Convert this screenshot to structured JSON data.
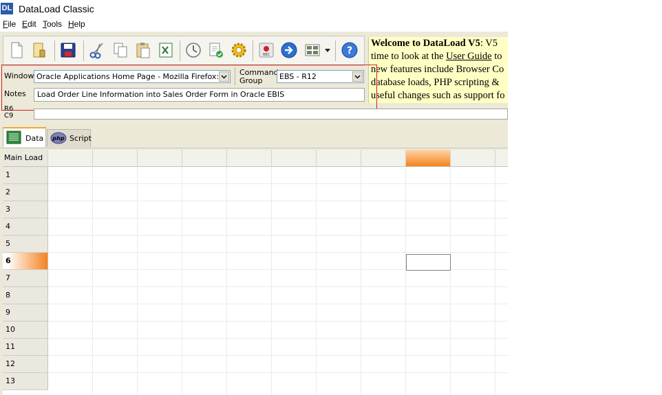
{
  "window": {
    "title": "DataLoad Classic",
    "logo_text": "DL"
  },
  "menu": [
    {
      "label": "File",
      "accel": "F",
      "rest": "ile"
    },
    {
      "label": "Edit",
      "accel": "E",
      "rest": "dit"
    },
    {
      "label": "Tools",
      "accel": "T",
      "rest": "ools"
    },
    {
      "label": "Help",
      "accel": "H",
      "rest": "elp"
    }
  ],
  "toolbar": {
    "buttons": [
      "new-file-icon",
      "open-file-icon",
      "save-icon",
      "cut-icon",
      "copy-icon",
      "paste-icon",
      "excel-icon",
      "delay-clock-icon",
      "validate-icon",
      "settings-gear-icon",
      "record-icon",
      "run-arrow-icon",
      "layout-icon",
      "dropdown-arrow-icon",
      "help-icon"
    ],
    "record_label": "REC",
    "help_label": "?"
  },
  "welcome": {
    "line1_bold": "Welcome to DataLoad V5",
    "line1_rest": ": V5",
    "line2_pre": "time to look at the ",
    "line2_link": "User Guide",
    "line2_post": " to",
    "line3": "new features include Browser Co",
    "line4": "database loads, PHP scripting &",
    "line5": "useful changes such as support fo"
  },
  "form": {
    "window_label": "Window",
    "window_value": "Oracle Applications Home Page - Mozilla Firefox: IBM Ed",
    "command_group_label_1": "Command",
    "command_group_label_2": "Group",
    "command_group_value": "EBS - R12",
    "notes_label": "Notes",
    "notes_value": "Load Order Line Information into Sales Order Form in Oracle EBIS",
    "row_ref": "R6",
    "col_ref": "C9"
  },
  "tabs": [
    {
      "label": "Data",
      "active": true
    },
    {
      "label": "Script",
      "active": false
    }
  ],
  "grid": {
    "corner_label": "Main Load",
    "row_numbers": [
      "1",
      "2",
      "3",
      "4",
      "5",
      "6",
      "7",
      "8",
      "9",
      "10",
      "11",
      "12",
      "13"
    ],
    "active_row": "6",
    "active_column": 9,
    "highlight_color": "#f58220"
  }
}
